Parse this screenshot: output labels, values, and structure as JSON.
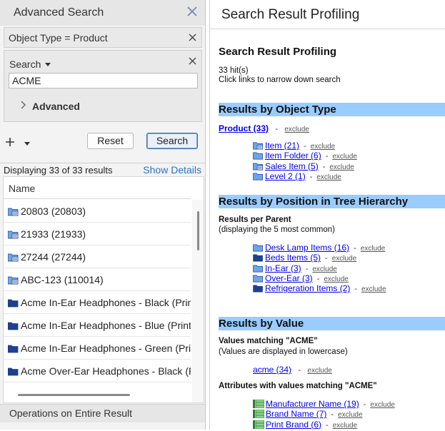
{
  "left_panel": {
    "title": "Advanced Search",
    "filter_object_type": "Object Type = Product",
    "search_label": "Search",
    "search_value": "ACME",
    "advanced_label": "Advanced",
    "reset_label": "Reset",
    "search_button_label": "Search",
    "results_count": "Displaying 33 of 33 results",
    "show_details": "Show Details",
    "column_name": "Name",
    "rows": [
      {
        "icon": "folder-item-icon",
        "text": "20803 (20803)"
      },
      {
        "icon": "folder-item-icon",
        "text": "21933 (21933)"
      },
      {
        "icon": "folder-item-icon",
        "text": "27244 (27244)"
      },
      {
        "icon": "folder-item-icon",
        "text": "ABC-123 (110014)"
      },
      {
        "icon": "dark-folder-icon",
        "text": "Acme In-Ear Headphones - Black (Print_"
      },
      {
        "icon": "dark-folder-icon",
        "text": "Acme In-Ear Headphones - Blue (Print_l"
      },
      {
        "icon": "dark-folder-icon",
        "text": "Acme In-Ear Headphones - Green (Print"
      },
      {
        "icon": "dark-folder-icon",
        "text": "Acme Over-Ear Headphones - Black (Pri"
      }
    ],
    "operations_label": "Operations on Entire Result"
  },
  "right_panel": {
    "header_title": "Search Result Profiling",
    "section_title": "Search Result Profiling",
    "hits": "33 hit(s)",
    "hint": "Click links to narrow down search",
    "by_type": {
      "title": "Results by Object Type",
      "top_link": "Product (33)",
      "exclude": "exclude",
      "items": [
        {
          "icon": "folder-item-icon",
          "label": "Item (21)"
        },
        {
          "icon": "light-folder-icon",
          "label": "Item Folder (6)"
        },
        {
          "icon": "folder-item-icon",
          "label": "Sales Item (5)"
        },
        {
          "icon": "light-folder-icon",
          "label": "Level 2 (1)"
        }
      ]
    },
    "by_position": {
      "title": "Results by Position in Tree Hierarchy",
      "subtitle": "Results per Parent",
      "note": "(displaying the 5 most common)",
      "exclude": "exclude",
      "items": [
        {
          "icon": "light-folder-icon",
          "label": "Desk Lamp Items (16)"
        },
        {
          "icon": "dark-folder-icon",
          "label": "Beds Items (5)"
        },
        {
          "icon": "light-folder-icon",
          "label": "In-Ear (3)"
        },
        {
          "icon": "light-folder-icon",
          "label": "Over-Ear (3)"
        },
        {
          "icon": "dark-folder-icon",
          "label": "Refrigeration Items (2)"
        }
      ]
    },
    "by_value": {
      "title": "Results by Value",
      "subtitle": "Values matching \"ACME\"",
      "note": "(Values are displayed in lowercase)",
      "value_link": "acme (34)",
      "exclude": "exclude",
      "attributes_title": "Attributes with values matching \"ACME\"",
      "attributes": [
        {
          "icon": "attribute-icon",
          "label": "Manufacturer Name (19)"
        },
        {
          "icon": "attribute-icon",
          "label": "Brand Name (7)"
        },
        {
          "icon": "attribute-icon",
          "label": "Print Brand (6)"
        }
      ]
    }
  },
  "colors": {
    "band": "#99ccff",
    "link": "#0000ee",
    "accent": "#2f72c4",
    "folder_dark": "#1f3f8f",
    "folder_light": "#6aa6e8"
  }
}
